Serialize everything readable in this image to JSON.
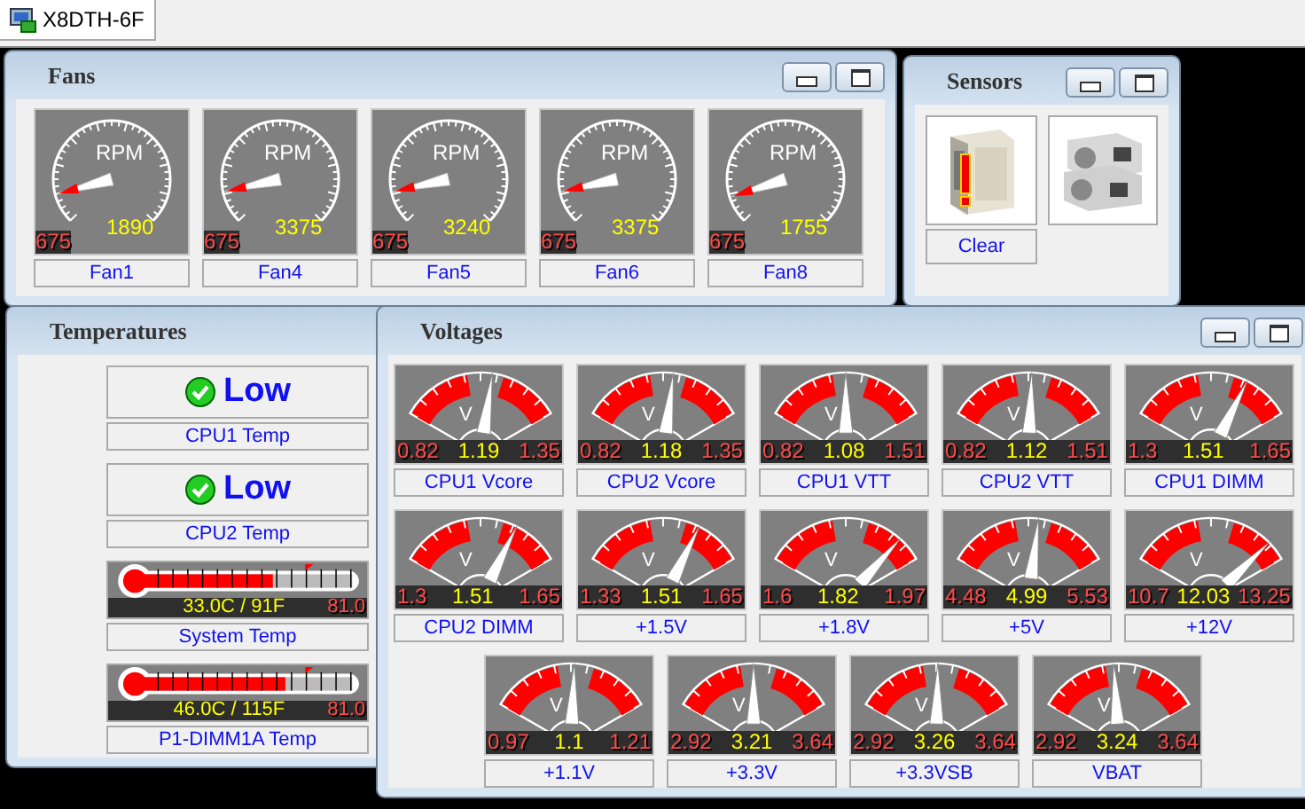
{
  "tab": {
    "label": "X8DTH-6F",
    "selected": true
  },
  "fans": {
    "title": "Fans",
    "gauges": [
      {
        "label": "Fan1",
        "unit": "RPM",
        "min": "675",
        "value": "1890",
        "level": 0.11
      },
      {
        "label": "Fan4",
        "unit": "RPM",
        "min": "675",
        "value": "3375",
        "level": 0.12
      },
      {
        "label": "Fan5",
        "unit": "RPM",
        "min": "675",
        "value": "3240",
        "level": 0.12
      },
      {
        "label": "Fan6",
        "unit": "RPM",
        "min": "675",
        "value": "3375",
        "level": 0.12
      },
      {
        "label": "Fan8",
        "unit": "RPM",
        "min": "675",
        "value": "1755",
        "level": 0.1
      }
    ]
  },
  "sensors": {
    "title": "Sensors",
    "button": "Clear"
  },
  "temperatures": {
    "title": "Temperatures",
    "items": [
      {
        "kind": "status",
        "status": "Low",
        "ok": true,
        "label": "CPU1 Temp"
      },
      {
        "kind": "status",
        "status": "Low",
        "ok": true,
        "label": "CPU2 Temp"
      },
      {
        "kind": "thermometer",
        "reading": "33.0C / 91F",
        "max": "81.0",
        "level": 0.62,
        "label": "System Temp"
      },
      {
        "kind": "thermometer",
        "reading": "46.0C / 115F",
        "max": "81.0",
        "level": 0.68,
        "label": "P1-DIMM1A Temp"
      }
    ]
  },
  "voltages": {
    "title": "Voltages",
    "gauges": [
      {
        "label": "CPU1 Vcore",
        "unit": "V",
        "min": "0.82",
        "value": "1.19",
        "max": "1.35",
        "level": 0.57
      },
      {
        "label": "CPU2 Vcore",
        "unit": "V",
        "min": "0.82",
        "value": "1.18",
        "max": "1.35",
        "level": 0.56
      },
      {
        "label": "CPU1 VTT",
        "unit": "V",
        "min": "0.82",
        "value": "1.08",
        "max": "1.51",
        "level": 0.5
      },
      {
        "label": "CPU2 VTT",
        "unit": "V",
        "min": "0.82",
        "value": "1.12",
        "max": "1.51",
        "level": 0.52
      },
      {
        "label": "CPU1 DIMM",
        "unit": "V",
        "min": "1.3",
        "value": "1.51",
        "max": "1.65",
        "level": 0.72
      },
      {
        "label": "CPU2 DIMM",
        "unit": "V",
        "min": "1.3",
        "value": "1.51",
        "max": "1.65",
        "level": 0.72
      },
      {
        "label": "+1.5V",
        "unit": "V",
        "min": "1.33",
        "value": "1.51",
        "max": "1.65",
        "level": 0.72
      },
      {
        "label": "+1.8V",
        "unit": "V",
        "min": "1.6",
        "value": "1.82",
        "max": "1.97",
        "level": 0.85
      },
      {
        "label": "+5V",
        "unit": "V",
        "min": "4.48",
        "value": "4.99",
        "max": "5.53",
        "level": 0.56
      },
      {
        "label": "+12V",
        "unit": "V",
        "min": "10.7",
        "value": "12.03",
        "max": "13.25",
        "level": 0.88
      },
      {
        "label": "+1.1V",
        "unit": "V",
        "min": "0.97",
        "value": "1.1",
        "max": "1.21",
        "level": 0.52
      },
      {
        "label": "+3.3V",
        "unit": "V",
        "min": "2.92",
        "value": "3.21",
        "max": "3.64",
        "level": 0.5
      },
      {
        "label": "+3.3VSB",
        "unit": "V",
        "min": "2.92",
        "value": "3.26",
        "max": "3.64",
        "level": 0.51
      },
      {
        "label": "VBAT",
        "unit": "V",
        "min": "2.92",
        "value": "3.24",
        "max": "3.64",
        "level": 0.47
      }
    ]
  }
}
